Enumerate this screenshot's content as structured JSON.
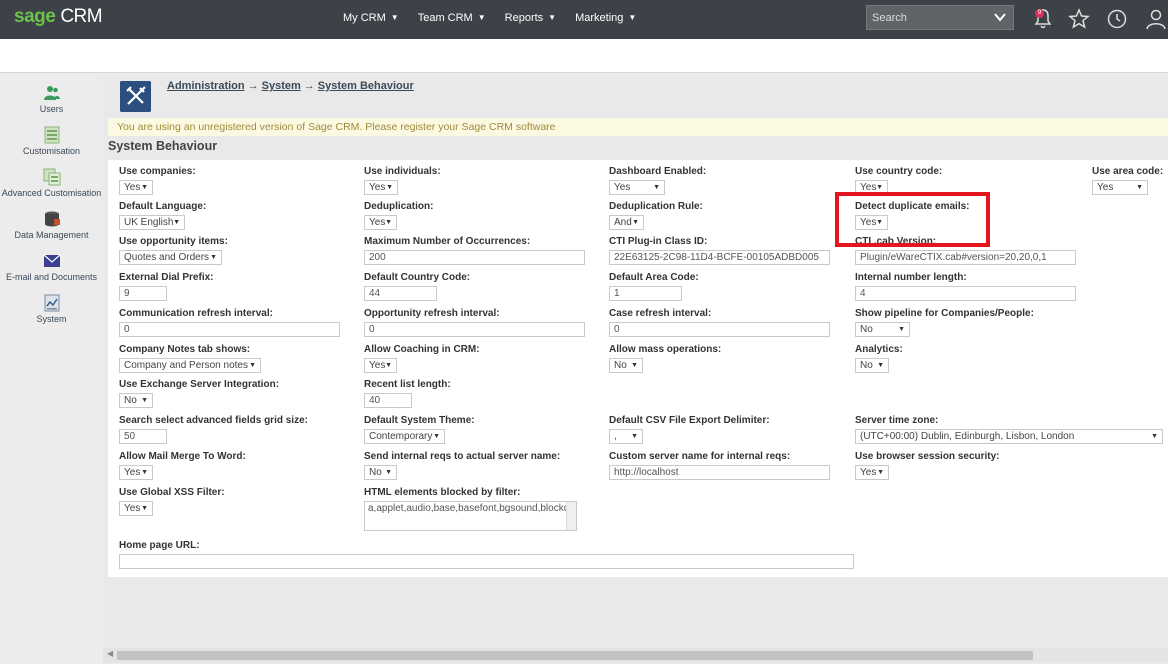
{
  "brand": {
    "sage": "sage",
    "crm": "CRM"
  },
  "nav": [
    "My CRM",
    "Team CRM",
    "Reports",
    "Marketing"
  ],
  "search": {
    "placeholder": "Search"
  },
  "notifications": {
    "count": "9"
  },
  "sidebar": [
    {
      "label": "Users",
      "icon": "users-icon"
    },
    {
      "label": "Customisation",
      "icon": "customisation-icon"
    },
    {
      "label": "Advanced Customisation",
      "icon": "advanced-customisation-icon"
    },
    {
      "label": "Data Management",
      "icon": "data-management-icon"
    },
    {
      "label": "E-mail and Documents",
      "icon": "email-icon"
    },
    {
      "label": "System",
      "icon": "system-icon"
    }
  ],
  "breadcrumb": {
    "admin": "Administration",
    "system": "System",
    "behaviour": "System Behaviour",
    "sep": "→"
  },
  "warning": "You are using an unregistered version of Sage CRM. Please register your Sage CRM software",
  "section_title": "System Behaviour",
  "fields": {
    "use_companies": {
      "label": "Use companies:",
      "value": "Yes"
    },
    "use_individuals": {
      "label": "Use individuals:",
      "value": "Yes"
    },
    "dashboard_enabled": {
      "label": "Dashboard Enabled:",
      "value": "Yes"
    },
    "use_country_code": {
      "label": "Use country code:",
      "value": "Yes"
    },
    "use_area_code": {
      "label": "Use area code:",
      "value": "Yes"
    },
    "default_language": {
      "label": "Default Language:",
      "value": "UK English"
    },
    "deduplication": {
      "label": "Deduplication:",
      "value": "Yes"
    },
    "deduplication_rule": {
      "label": "Deduplication Rule:",
      "value": "And"
    },
    "detect_duplicate_emails": {
      "label": "Detect duplicate emails:",
      "value": "Yes"
    },
    "use_opportunity_items": {
      "label": "Use opportunity items:",
      "value": "Quotes and Orders"
    },
    "max_occurrences": {
      "label": "Maximum Number of Occurrences:",
      "value": "200"
    },
    "cti_plugin_class_id": {
      "label": "CTI Plug-in Class ID:",
      "value": "22E63125-2C98-11D4-BCFE-00105ADBD005"
    },
    "cti_cab_version": {
      "label": "CTI .cab Version:",
      "value": "Plugin/eWareCTIX.cab#version=20,20,0,1"
    },
    "external_dial_prefix": {
      "label": "External Dial Prefix:",
      "value": "9"
    },
    "default_country_code": {
      "label": "Default Country Code:",
      "value": "44"
    },
    "default_area_code": {
      "label": "Default Area Code:",
      "value": "1"
    },
    "internal_number_length": {
      "label": "Internal number length:",
      "value": "4"
    },
    "comm_refresh": {
      "label": "Communication refresh interval:",
      "value": "0"
    },
    "opp_refresh": {
      "label": "Opportunity refresh interval:",
      "value": "0"
    },
    "case_refresh": {
      "label": "Case refresh interval:",
      "value": "0"
    },
    "show_pipeline": {
      "label": "Show pipeline for Companies/People:",
      "value": "No"
    },
    "company_notes_tab": {
      "label": "Company Notes tab shows:",
      "value": "Company and Person notes"
    },
    "allow_coaching": {
      "label": "Allow Coaching in CRM:",
      "value": "Yes"
    },
    "allow_mass_operations": {
      "label": "Allow mass operations:",
      "value": "No"
    },
    "analytics": {
      "label": "Analytics:",
      "value": "No"
    },
    "use_exchange": {
      "label": "Use Exchange Server Integration:",
      "value": "No"
    },
    "recent_list_length": {
      "label": "Recent list length:",
      "value": "40"
    },
    "search_grid_size": {
      "label": "Search select advanced fields grid size:",
      "value": "50"
    },
    "default_theme": {
      "label": "Default System Theme:",
      "value": "Contemporary"
    },
    "csv_delimiter": {
      "label": "Default CSV File Export Delimiter:",
      "value": ","
    },
    "server_time_zone": {
      "label": "Server time zone:",
      "value": "(UTC+00:00) Dublin, Edinburgh, Lisbon, London"
    },
    "allow_mail_merge": {
      "label": "Allow Mail Merge To Word:",
      "value": "Yes"
    },
    "send_internal_reqs": {
      "label": "Send internal reqs to actual server name:",
      "value": "No"
    },
    "custom_server_name": {
      "label": "Custom server name for internal reqs:",
      "value": "http://localhost"
    },
    "browser_session_security": {
      "label": "Use browser session security:",
      "value": "Yes"
    },
    "global_xss": {
      "label": "Use Global XSS Filter:",
      "value": "Yes"
    },
    "html_blocked": {
      "label": "HTML elements blocked by filter:",
      "value": "a,applet,audio,base,basefont,bgsound,blockquote,body,br,button,cite,content,data,div,"
    },
    "home_page_url": {
      "label": "Home page URL:",
      "value": ""
    }
  },
  "colors": {
    "topbar": "#3c4247",
    "brand_green": "#6cc24a",
    "highlight": "#e4151c",
    "warning_bg": "#fcf9e3"
  }
}
